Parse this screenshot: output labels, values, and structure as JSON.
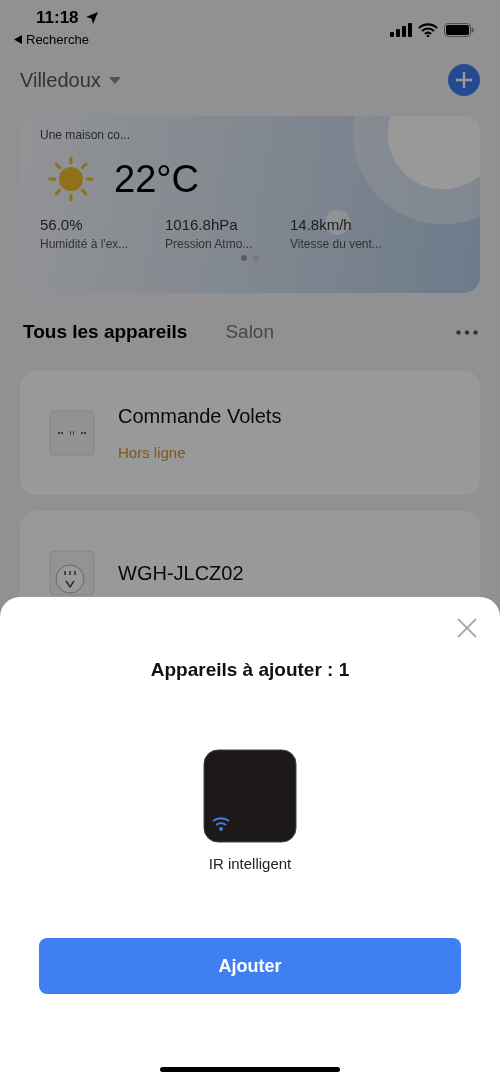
{
  "status_bar": {
    "time": "11:18",
    "back_label": "Recherche"
  },
  "header": {
    "home_name": "Villedoux"
  },
  "weather": {
    "title": "Une maison co...",
    "temperature": "22°C",
    "stats": [
      {
        "value": "56.0%",
        "label": "Humidité à l'ex..."
      },
      {
        "value": "1016.8hPa",
        "label": "Pression Atmo..."
      },
      {
        "value": "14.8km/h",
        "label": "Vitesse du vent..."
      }
    ],
    "page_dots": [
      {
        "selected": true
      },
      {
        "selected": false
      }
    ]
  },
  "tabs": [
    {
      "label": "Tous les appareils",
      "selected": true
    },
    {
      "label": "Salon",
      "selected": false
    }
  ],
  "devices": [
    {
      "kind": "switch",
      "name": "Commande Volets",
      "status": "Hors ligne"
    },
    {
      "kind": "socket",
      "name": "WGH-JLCZ02"
    }
  ],
  "sheet": {
    "title": "Appareils à ajouter : 1",
    "found": [
      {
        "name": "IR intelligent"
      }
    ],
    "button": "Ajouter"
  }
}
